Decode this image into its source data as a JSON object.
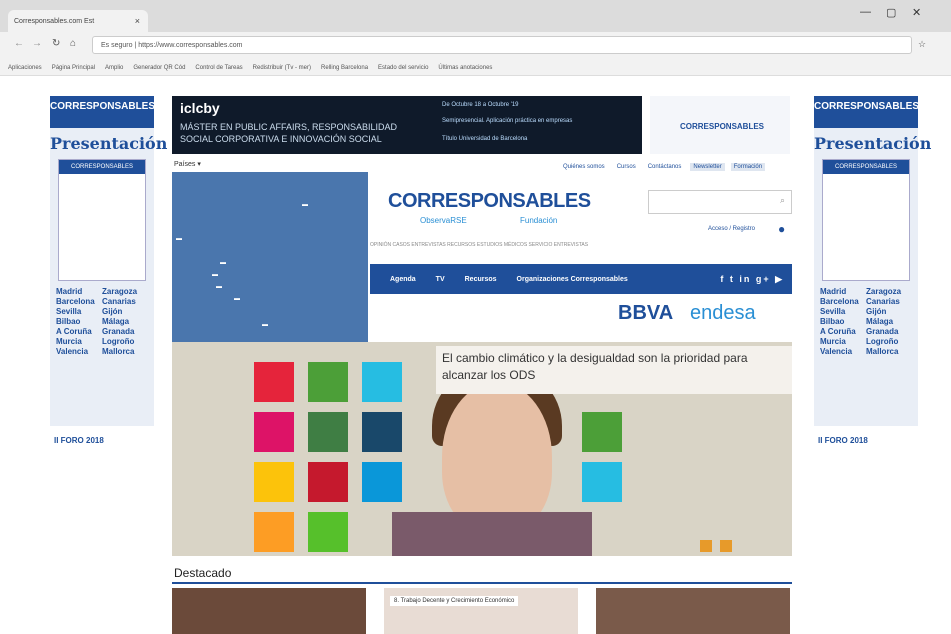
{
  "browser": {
    "tab_title": "Corresponsables.com Est",
    "url": "Es seguro | https://www.corresponsables.com",
    "bookmarks": [
      "Aplicaciones",
      "Página Principal",
      "Amplio",
      "Generador QR Cód",
      "Control de Tareas",
      "Redistribuir (Tv - mer)",
      "Relling Barcelona",
      "Estado del servicio",
      "Últimas anotaciones"
    ]
  },
  "side_banner": {
    "brand": "CORRESPONSABLES",
    "presentacion": "Presentación",
    "magazine_header": "CORRESPONSABLES",
    "cities": [
      "Madrid",
      "Zaragoza",
      "Barcelona",
      "Canarias",
      "Sevilla",
      "Gijón",
      "Bilbao",
      "Málaga",
      "A Coruña",
      "Granada",
      "Murcia",
      "Logroño",
      "Valencia",
      "Mallorca"
    ],
    "foro": "II FORO 2018"
  },
  "ad_banner": {
    "logo": "iclcby",
    "line1": "MÁSTER EN PUBLIC AFFAIRS, RESPONSABILIDAD",
    "line2": "SOCIAL CORPORATIVA E INNOVACIÓN SOCIAL",
    "right1": "De Octubre 18 a Octubre '19",
    "right2": "Semipresencial. Aplicación práctica en empresas",
    "right3": "Título Universidad de Barcelona"
  },
  "right_ad": {
    "text": "CORRESPONSABLES"
  },
  "paises": "Países",
  "top_nav": [
    "Quiénes somos",
    "Cursos",
    "Contáctanos",
    "Newsletter",
    "Formación"
  ],
  "brand": {
    "name": "CORRESPONSABLES",
    "sub1": "ObservaRSE",
    "sub2": "Fundación"
  },
  "login": "Acceso / Registro",
  "sec_nav": "OPINIÓN  CASOS  ENTREVISTAS  RECURSOS  ESTUDIOS  MÉDICOS  SERVICIO  ENTREVISTAS",
  "main_nav": [
    "Agenda",
    "TV",
    "Recursos",
    "Organizaciones Corresponsables"
  ],
  "social": "f t in g+ ▶",
  "sponsors": {
    "bbva": "BBVA",
    "endesa": "endesa"
  },
  "hero": {
    "caption": "El cambio climático y la desigualdad son la prioridad para alcanzar los ODS"
  },
  "destacado": "Destacado",
  "thumb2": "8. Trabajo Decente y Crecimiento Económico",
  "colors": {
    "primary": "#1f4f9a",
    "accent": "#2a8fd4"
  }
}
